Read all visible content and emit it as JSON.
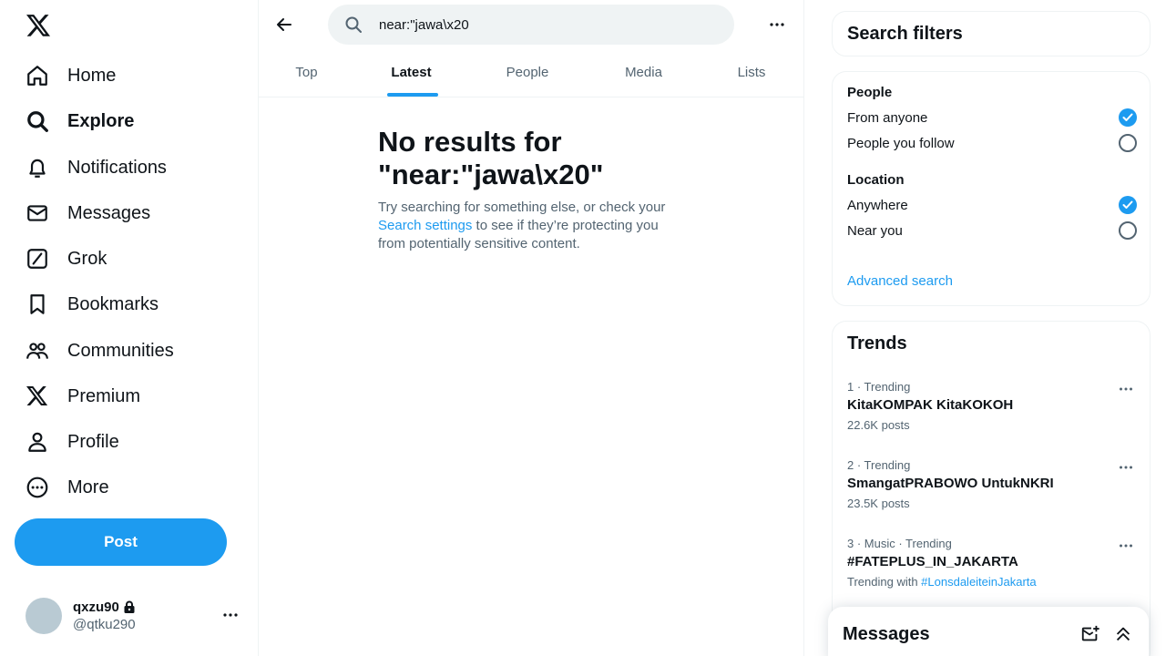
{
  "nav": {
    "items": [
      {
        "label": "Home",
        "icon": "home-icon"
      },
      {
        "label": "Explore",
        "icon": "search-icon",
        "active": true
      },
      {
        "label": "Notifications",
        "icon": "bell-icon"
      },
      {
        "label": "Messages",
        "icon": "envelope-icon"
      },
      {
        "label": "Grok",
        "icon": "grok-icon"
      },
      {
        "label": "Bookmarks",
        "icon": "bookmark-icon"
      },
      {
        "label": "Communities",
        "icon": "people-icon"
      },
      {
        "label": "Premium",
        "icon": "x-logo-icon"
      },
      {
        "label": "Profile",
        "icon": "person-icon"
      },
      {
        "label": "More",
        "icon": "more-circle-icon"
      }
    ],
    "post_label": "Post"
  },
  "account": {
    "name": "qxzu90",
    "handle": "@qtku290"
  },
  "search": {
    "value": "near:\"jawa\\x20"
  },
  "tabs": [
    {
      "label": "Top"
    },
    {
      "label": "Latest",
      "active": true
    },
    {
      "label": "People"
    },
    {
      "label": "Media"
    },
    {
      "label": "Lists"
    }
  ],
  "empty_state": {
    "title": "No results for \"near:\"jawa\\x20\"",
    "body_before": "Try searching for something else, or check your ",
    "link": "Search settings",
    "body_after": " to see if they’re protecting you from potentially sensitive content."
  },
  "filters": {
    "title": "Search filters",
    "people_title": "People",
    "people_options": [
      {
        "label": "From anyone",
        "checked": true
      },
      {
        "label": "People you follow",
        "checked": false
      }
    ],
    "location_title": "Location",
    "location_options": [
      {
        "label": "Anywhere",
        "checked": true
      },
      {
        "label": "Near you",
        "checked": false
      }
    ],
    "advanced_link": "Advanced search"
  },
  "trends": {
    "title": "Trends",
    "items": [
      {
        "meta": "1 · Trending",
        "name": "KitaKOMPAK KitaKOKOH",
        "posts": "22.6K posts"
      },
      {
        "meta": "2 · Trending",
        "name": "SmangatPRABOWO UntukNKRI",
        "posts": "23.5K posts"
      },
      {
        "meta": "3 · Music · Trending",
        "name": "#FATEPLUS_IN_JAKARTA",
        "with_label": "Trending with ",
        "with_tag": "#LonsdaleiteinJakarta"
      }
    ]
  },
  "messages_drawer": {
    "title": "Messages"
  },
  "colors": {
    "accent": "#1d9bf0",
    "text": "#0f1419",
    "secondary": "#536471",
    "border": "#eff3f4"
  }
}
